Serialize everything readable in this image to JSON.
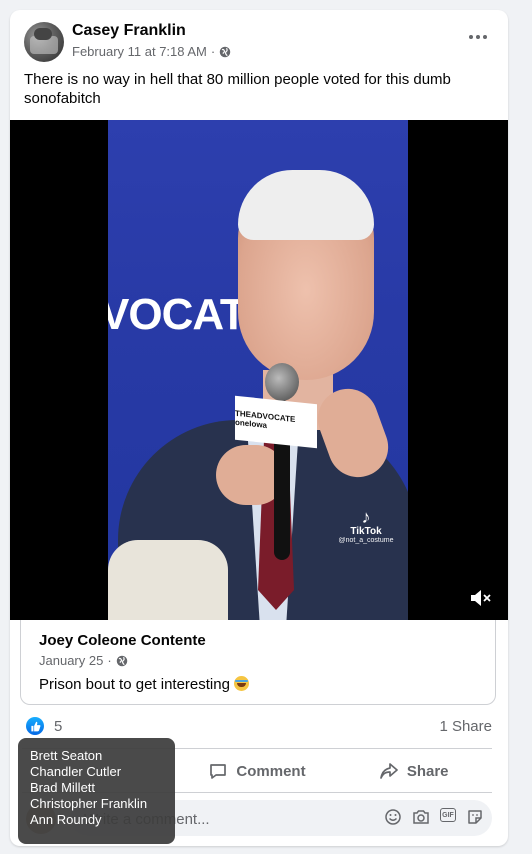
{
  "post": {
    "author": "Casey Franklin",
    "timestamp": "February 11 at 7:18 AM",
    "meta_separator": "·",
    "privacy_icon": "globe-icon",
    "text": "There is no way in hell that 80 million people voted for this dumb sonofabitch"
  },
  "video": {
    "banner_text": "VOCATE",
    "mic_flag_text": "THEADVOCATE oneIowa",
    "watermark_logo": "♪",
    "watermark_name": "TikTok",
    "watermark_handle": "@not_a_costume",
    "mute_icon": "speaker-muted-icon"
  },
  "shared_post": {
    "author": "Joey Coleone Contente",
    "timestamp": "January 25",
    "meta_separator": "·",
    "text": "Prison bout to get interesting",
    "emoji": "rolling-on-floor-laughing"
  },
  "reactions": {
    "count": "5",
    "shares": "1 Share",
    "tooltip_names": [
      "Brett Seaton",
      "Chandler Cutler",
      "Brad Millett",
      "Christopher Franklin",
      "Ann Roundy"
    ]
  },
  "actions": {
    "comment_label": "Comment",
    "share_label": "Share"
  },
  "composer": {
    "placeholder": "Write a comment..."
  },
  "colors": {
    "like_blue": "#0571ed",
    "secondary_text": "#65676b",
    "card_bg": "#ffffff",
    "page_bg": "#f0f2f5"
  }
}
